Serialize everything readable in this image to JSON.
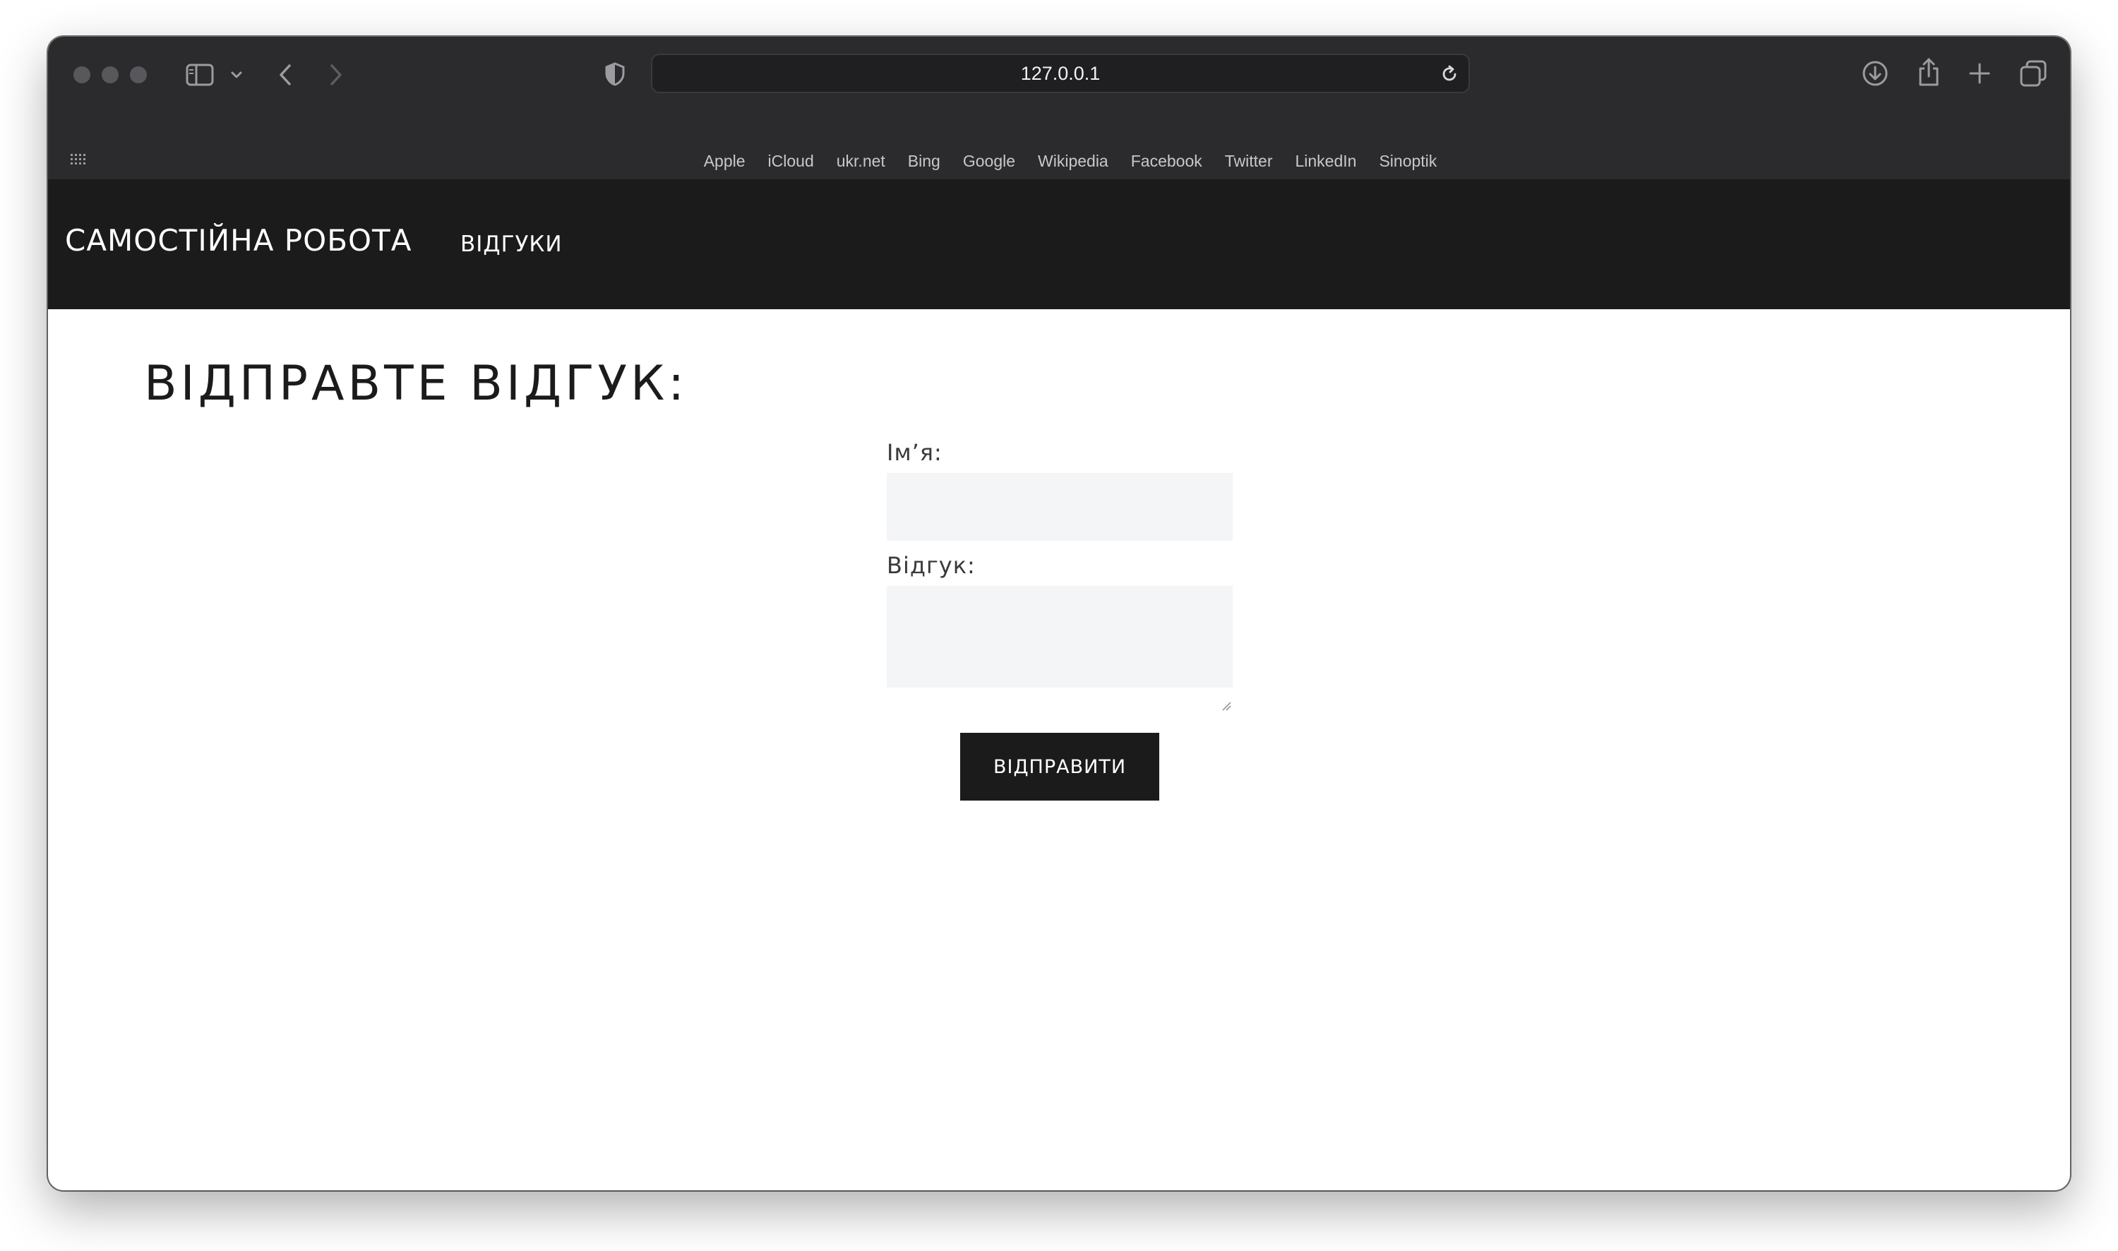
{
  "browser": {
    "url": "127.0.0.1",
    "bookmarks": [
      "Apple",
      "iCloud",
      "ukr.net",
      "Bing",
      "Google",
      "Wikipedia",
      "Facebook",
      "Twitter",
      "LinkedIn",
      "Sinoptik"
    ]
  },
  "site": {
    "brand": "САМОСТІЙНА РОБОТА",
    "nav": {
      "reviews": "ВІДГУКИ"
    }
  },
  "main": {
    "title": "ВІДПРАВТЕ ВІДГУК:",
    "form": {
      "name_label": "Імʼя:",
      "name_value": "",
      "review_label": "Відгук:",
      "review_value": "",
      "submit_label": "ВІДПРАВИТИ"
    }
  },
  "colors": {
    "header_bg": "#1b1b1b",
    "browser_chrome": "#2b2b2d",
    "field_bg": "#f4f5f7"
  }
}
